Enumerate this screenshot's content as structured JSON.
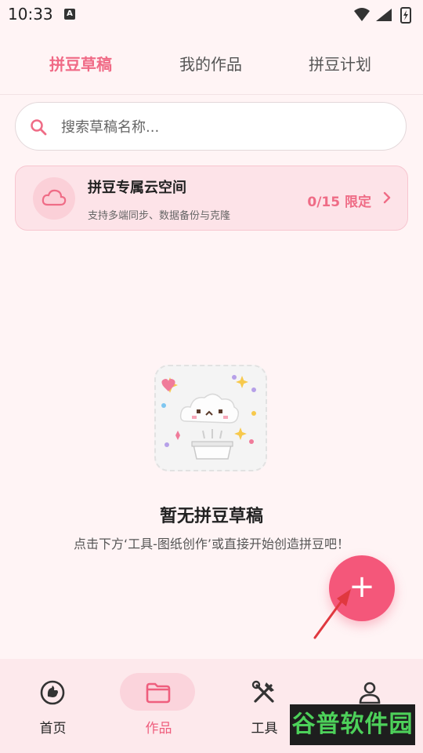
{
  "status_bar": {
    "time": "10:33",
    "a_icon_text": "A"
  },
  "tabs": [
    {
      "label": "拼豆草稿",
      "active": true
    },
    {
      "label": "我的作品",
      "active": false
    },
    {
      "label": "拼豆计划",
      "active": false
    }
  ],
  "search": {
    "placeholder": "搜索草稿名称..."
  },
  "cloud_card": {
    "title": "拼豆专属云空间",
    "subtitle": "支持多端同步、数据备份与克隆",
    "quota": "0/15 限定"
  },
  "empty_state": {
    "title": "暂无拼豆草稿",
    "subtitle": "点击下方‘工具-图纸创作’或直接开始创造拼豆吧！"
  },
  "fab": {
    "symbol": "+"
  },
  "bottom_nav": [
    {
      "label": "首页",
      "icon": "home-icon",
      "active": false
    },
    {
      "label": "作品",
      "icon": "folder-icon",
      "active": true
    },
    {
      "label": "工具",
      "icon": "tools-icon",
      "active": false
    },
    {
      "label": "",
      "icon": "profile-icon",
      "active": false
    }
  ],
  "watermark": {
    "text": "谷普软件园"
  },
  "colors": {
    "accent": "#f06a86",
    "background": "#fff4f5",
    "fab": "#f4577a"
  }
}
